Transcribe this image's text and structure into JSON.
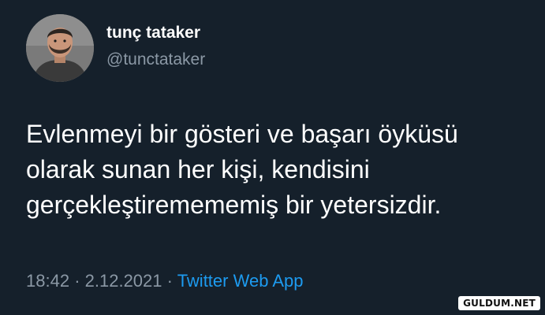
{
  "author": {
    "name": "tunç tataker",
    "handle": "@tunctataker"
  },
  "tweet": {
    "lines": [
      "Evlenmeyi bir gösteri ve başarı öyküsü",
      "olarak sunan her kişi, kendisini",
      "gerçekleştiremememiş bir yetersizdir."
    ],
    "time": "18:42",
    "separator1": "·",
    "date": "2.12.2021",
    "separator2": "·",
    "source": "Twitter Web App"
  },
  "watermark": "GULDUM.NET",
  "colors": {
    "background": "#15202b",
    "text": "#ffffff",
    "muted": "#8b98a5",
    "link": "#1d9bf0"
  }
}
